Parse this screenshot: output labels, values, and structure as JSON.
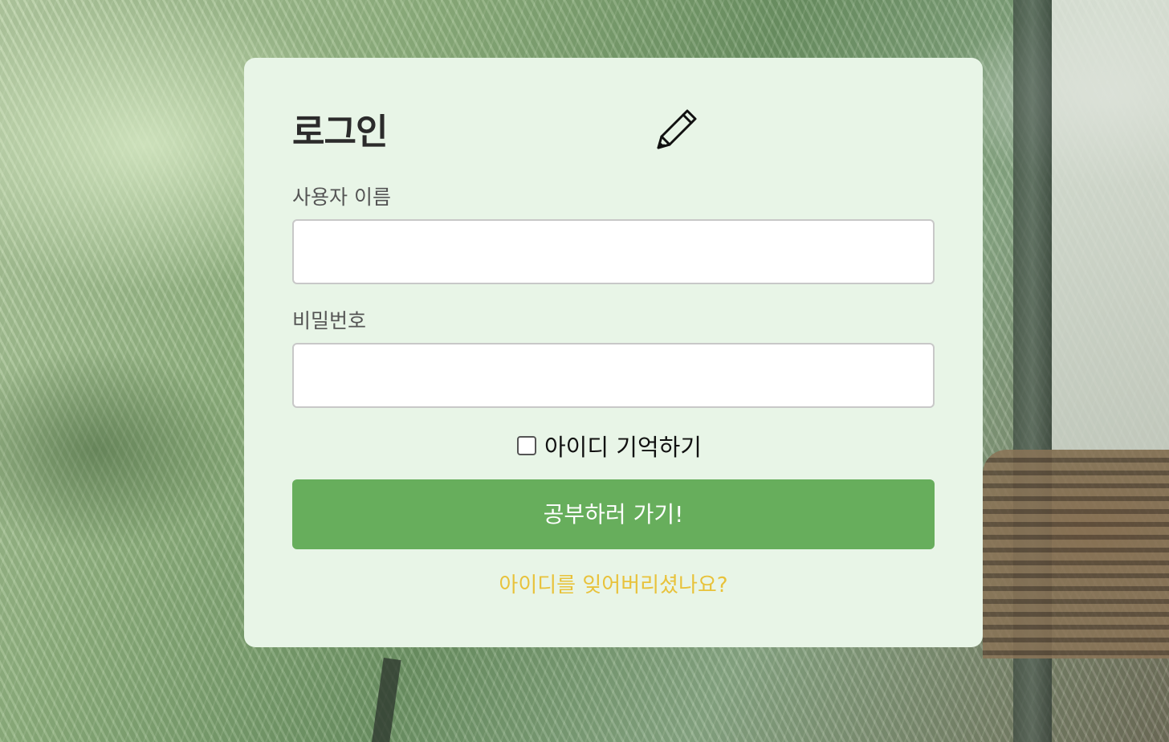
{
  "login": {
    "title": "로그인",
    "username_label": "사용자 이름",
    "username_value": "",
    "password_label": "비밀번호",
    "password_value": "",
    "remember_label": "아이디 기억하기",
    "remember_checked": false,
    "submit_label": "공부하러 가기!",
    "forgot_link": "아이디를 잊어버리셨나요?"
  },
  "icons": {
    "title_icon": "pencil-icon"
  },
  "colors": {
    "card_background": "#e8f5e7",
    "submit_button": "#67ae5c",
    "forgot_link": "#e8c23a",
    "title_text": "#2b2b2b",
    "label_text": "#555555"
  }
}
